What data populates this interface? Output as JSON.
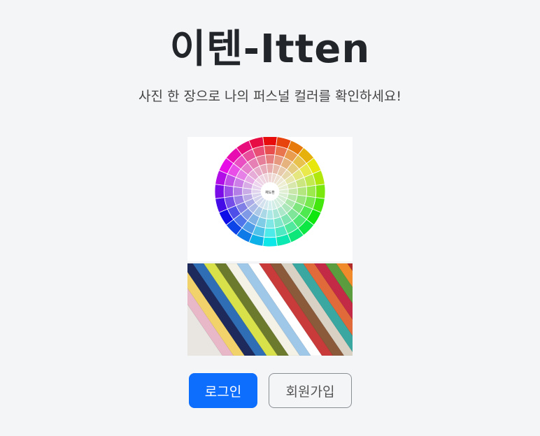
{
  "header": {
    "title": "이텐-Itten",
    "subtitle": "사진 한 장으로 나의 퍼스널 컬러를 확인하세요!"
  },
  "images": {
    "color_wheel": {
      "center_label": "채도환"
    },
    "fabric_swatches": {}
  },
  "actions": {
    "login_label": "로그인",
    "signup_label": "회원가입"
  },
  "colors": {
    "primary": "#0d6efd",
    "background": "#f4f5f7",
    "title_text": "#222529",
    "secondary_border": "#8a8f94"
  }
}
